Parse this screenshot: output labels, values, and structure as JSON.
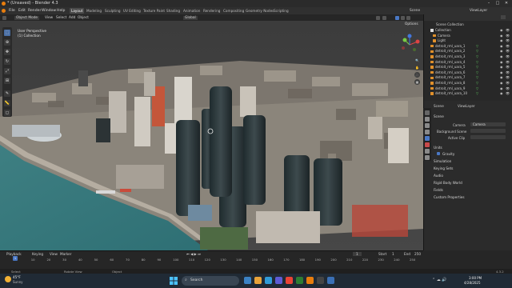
{
  "window": {
    "title": "* (Unsaved) - Blender 4.3"
  },
  "menus": [
    "File",
    "Edit",
    "Render",
    "Window",
    "Help"
  ],
  "workspaces": [
    "Layout",
    "Modeling",
    "Sculpting",
    "UV Editing",
    "Texture Paint",
    "Shading",
    "Animation",
    "Rendering",
    "Compositing",
    "Geometry Nodes",
    "Scripting"
  ],
  "scene": {
    "label": "Scene",
    "view_layer": "ViewLayer"
  },
  "viewport_header": {
    "mode": "Object Mode",
    "view": "View",
    "select": "Select",
    "add": "Add",
    "object": "Object",
    "orientation": "Global",
    "options": "Options"
  },
  "viewport": {
    "perspective": "User Perspective",
    "collection": "(1) Collection"
  },
  "outliner": {
    "title": "Scene Collection",
    "rows": [
      {
        "label": "Collection",
        "kind": "collection"
      },
      {
        "label": "Camera",
        "kind": "camera"
      },
      {
        "label": "Light",
        "kind": "light"
      },
      {
        "label": "detroit_rml_uara_1",
        "kind": "mesh"
      },
      {
        "label": "detroit_rml_uara_2",
        "kind": "mesh"
      },
      {
        "label": "detroit_rml_uara_3",
        "kind": "mesh"
      },
      {
        "label": "detroit_rml_uara_4",
        "kind": "mesh"
      },
      {
        "label": "detroit_rml_uara_5",
        "kind": "mesh"
      },
      {
        "label": "detroit_rml_uara_6",
        "kind": "mesh"
      },
      {
        "label": "detroit_rml_uara_7",
        "kind": "mesh"
      },
      {
        "label": "detroit_rml_uara_8",
        "kind": "mesh"
      },
      {
        "label": "detroit_rml_uara_9",
        "kind": "mesh"
      },
      {
        "label": "detroit_rml_uara_10",
        "kind": "mesh"
      }
    ]
  },
  "properties": {
    "breadcrumb_scene": "Scene",
    "breadcrumb_layer": "ViewLayer",
    "section_scene": "Scene",
    "camera_label": "Camera",
    "camera_value": "Camera",
    "background_label": "Background Scene",
    "active_clip_label": "Active Clip",
    "sections": [
      "Units",
      "Gravity",
      "Simulation",
      "Keying Sets",
      "Audio",
      "Rigid Body World",
      "Fields",
      "Custom Properties"
    ],
    "section_units": "Units",
    "gravity": "Gravity",
    "simulation": "Simulation",
    "keying_sets": "Keying Sets",
    "audio": "Audio",
    "rigid_body": "Rigid Body World",
    "fields": "Fields",
    "custom_props": "Custom Properties"
  },
  "timeline": {
    "playback": "Playback",
    "keying": "Keying",
    "view": "View",
    "marker": "Marker",
    "current_frame": "1",
    "start_label": "Start",
    "start_value": "1",
    "end_label": "End",
    "end_value": "250",
    "ticks": [
      "0",
      "10",
      "20",
      "30",
      "40",
      "50",
      "60",
      "70",
      "80",
      "90",
      "100",
      "110",
      "120",
      "130",
      "140",
      "150",
      "160",
      "170",
      "180",
      "190",
      "200",
      "210",
      "220",
      "230",
      "240",
      "250"
    ]
  },
  "statusbar": {
    "select": "Select",
    "rotate": "Rotate View",
    "object": "Object",
    "version": "4.3.2"
  },
  "taskbar": {
    "weather_temp": "45°F",
    "weather_desc": "Sunny",
    "search_placeholder": "Search",
    "time": "3:00 PM",
    "date": "4/28/2025"
  }
}
